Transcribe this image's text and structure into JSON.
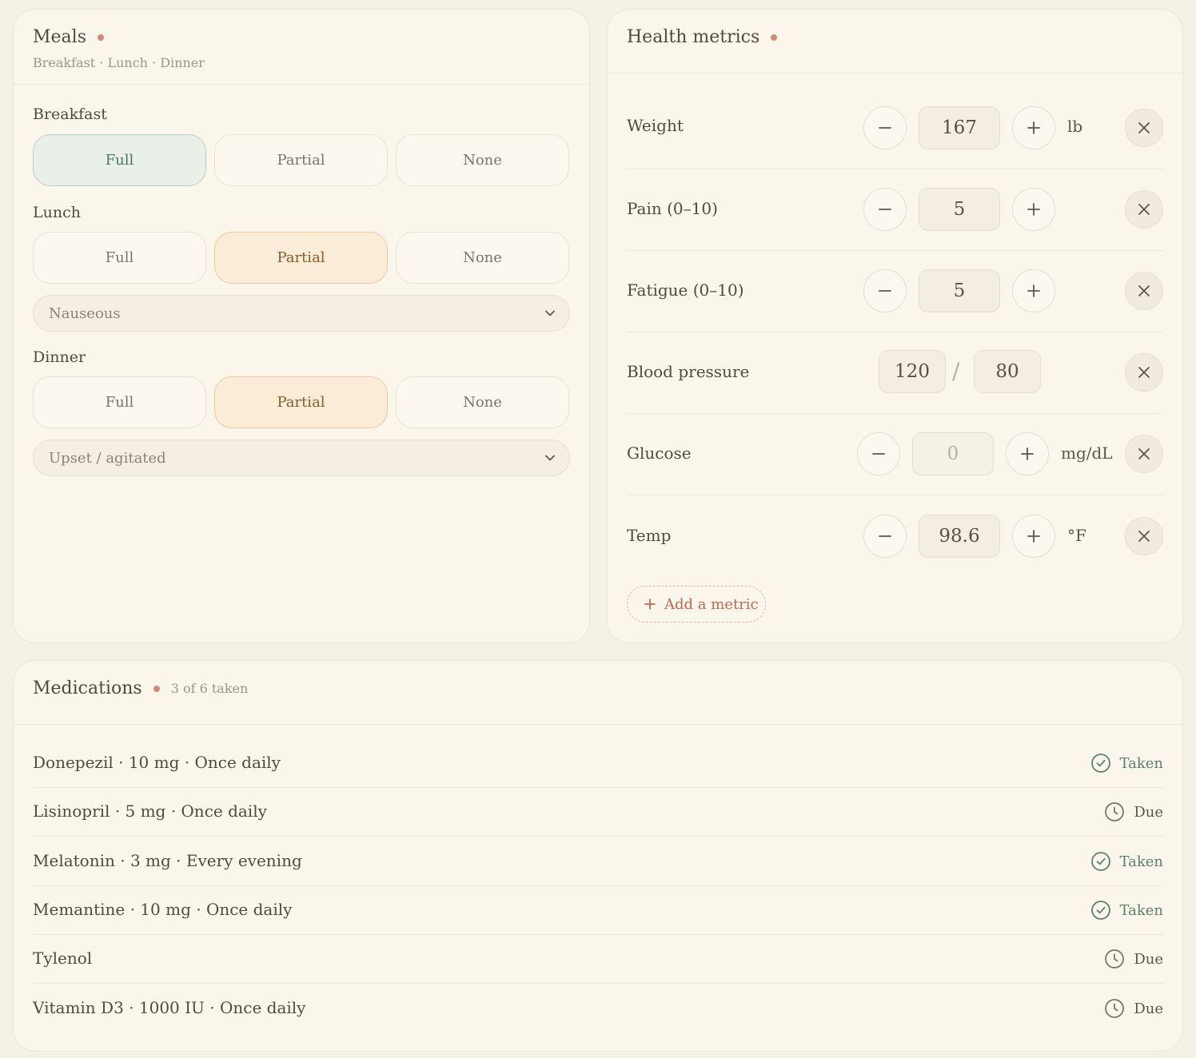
{
  "meals": {
    "title": "Meals",
    "subtitle": "Breakfast · Lunch · Dinner",
    "options": {
      "full": "Full",
      "partial": "Partial",
      "none": "None"
    },
    "breakfast": {
      "label": "Breakfast",
      "selected": "Full"
    },
    "lunch": {
      "label": "Lunch",
      "selected": "Partial",
      "mood": "Nauseous"
    },
    "dinner": {
      "label": "Dinner",
      "selected": "Partial",
      "mood": "Upset / agitated"
    }
  },
  "health": {
    "title": "Health metrics",
    "metrics": [
      {
        "label": "Weight",
        "value": "167",
        "unit": "lb"
      },
      {
        "label": "Pain (0–10)",
        "value": "5",
        "unit": ""
      },
      {
        "label": "Fatigue (0–10)",
        "value": "5",
        "unit": ""
      },
      {
        "label": "Blood pressure",
        "systolic": "120",
        "separator": "/",
        "diastolic": "80"
      },
      {
        "label": "Glucose",
        "value": "0",
        "unit": "mg/dL"
      },
      {
        "label": "Temp",
        "value": "98.6",
        "unit": "°F"
      }
    ],
    "add_label": "Add a metric"
  },
  "meds": {
    "title": "Medications",
    "count": "3 of 6 taken",
    "items": [
      {
        "name": "Donepezil · 10 mg · Once daily",
        "status": "Taken"
      },
      {
        "name": "Lisinopril · 5 mg · Once daily",
        "status": "Due"
      },
      {
        "name": "Melatonin · 3 mg · Every evening",
        "status": "Taken"
      },
      {
        "name": "Memantine · 10 mg · Once daily",
        "status": "Taken"
      },
      {
        "name": "Tylenol",
        "status": "Due"
      },
      {
        "name": "Vitamin D3 · 1000 IU · Once daily",
        "status": "Due"
      }
    ]
  },
  "icons": {
    "minus": "minus-icon",
    "plus": "plus-icon",
    "remove": "close-icon",
    "taken": "check-circle-icon",
    "due": "clock-icon",
    "dropdown": "chevron-down-icon"
  },
  "colors": {
    "accent": "#d08a76",
    "full_bg": "#e9f0e9",
    "partial_bg": "#fbecd8",
    "taken": "#5b7f6d",
    "add": "#c2694f"
  }
}
